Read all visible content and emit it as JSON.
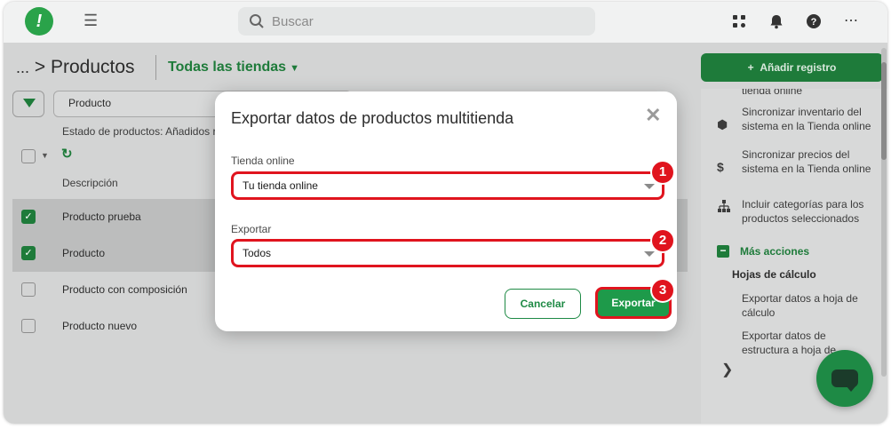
{
  "topbar": {
    "logo_text": "!",
    "search_placeholder": "Buscar"
  },
  "header": {
    "breadcrumb_dots": "...",
    "breadcrumb_sep": ">",
    "title": "Productos",
    "store_filter": "Todas las tiendas",
    "add_button": "Añadir registro"
  },
  "filter": {
    "field_value": "Producto",
    "description": "Estado de productos: Añadidos r"
  },
  "table": {
    "column_header": "Descripción",
    "rows": [
      {
        "label": "Producto prueba",
        "checked": true
      },
      {
        "label": "Producto",
        "checked": true
      },
      {
        "label": "Producto con composición",
        "checked": false
      },
      {
        "label": "Producto nuevo",
        "checked": false
      }
    ]
  },
  "sidebar": {
    "top_partial": "tienda online",
    "items": [
      {
        "icon": "box-icon",
        "label": "Sincronizar inventario del sistema en la Tienda online"
      },
      {
        "icon": "dollar-icon",
        "label": "Sincronizar precios del sistema en la Tienda online"
      },
      {
        "icon": "sitemap-icon",
        "label": "Incluir categorías para los productos seleccionados"
      }
    ],
    "more_actions": "Más acciones",
    "sheets_heading": "Hojas de cálculo",
    "sheet_actions": [
      "Exportar datos a hoja de cálculo",
      "Exportar datos de estructura a hoja de"
    ]
  },
  "modal": {
    "title": "Exportar datos de productos multitienda",
    "store_label": "Tienda online",
    "store_value": "Tu tienda online",
    "export_label": "Exportar",
    "export_value": "Todos",
    "cancel_button": "Cancelar",
    "export_button": "Exportar",
    "badges": [
      "1",
      "2",
      "3"
    ]
  },
  "colors": {
    "brand_green": "#1e8a45",
    "highlight_red": "#e0141e"
  }
}
